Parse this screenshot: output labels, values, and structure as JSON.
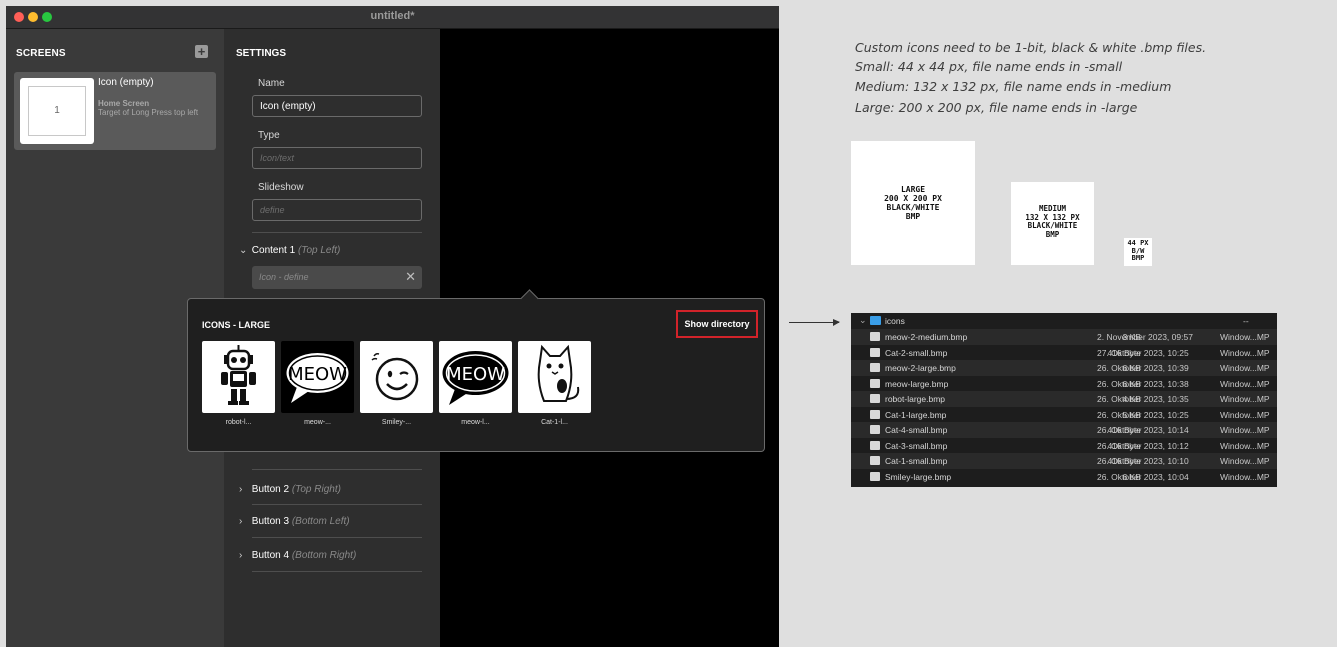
{
  "window": {
    "title": "untitled*"
  },
  "screens": {
    "title": "SCREENS",
    "add_label": "+",
    "card": {
      "number": "1",
      "name": "Icon (empty)",
      "subtitle": "Home Screen",
      "description": "Target of Long Press top left"
    }
  },
  "settings": {
    "title": "SETTINGS",
    "name_label": "Name",
    "name_value": "Icon (empty)",
    "type_label": "Type",
    "type_placeholder": "Icon/text",
    "slideshow_label": "Slideshow",
    "slideshow_placeholder": "define",
    "content1": {
      "label": "Content 1",
      "sub": "(Top Left)",
      "icon_placeholder": "Icon - define",
      "clear": "✕"
    },
    "buttons": [
      {
        "label": "Button 2",
        "sub": "(Top Right)"
      },
      {
        "label": "Button 3",
        "sub": "(Bottom Left)"
      },
      {
        "label": "Button 4",
        "sub": "(Bottom Right)"
      }
    ]
  },
  "popover": {
    "title": "ICONS - LARGE",
    "show_directory": "Show directory",
    "icons": [
      {
        "caption": "robot-l...",
        "icon": "robot-icon"
      },
      {
        "caption": "meow-...",
        "icon": "meow-speech-icon"
      },
      {
        "caption": "Smiley-...",
        "icon": "smiley-icon"
      },
      {
        "caption": "meow-l...",
        "icon": "meow-speech-icon"
      },
      {
        "caption": "Cat-1-l...",
        "icon": "cat-icon"
      }
    ]
  },
  "notes": [
    "Custom icons need to be 1-bit, black & white .bmp files.",
    "Small: 44 x 44 px, file name ends in -small",
    "Medium: 132 x 132 px, file name ends in -medium",
    "Large: 200 x 200 px, file name ends in -large"
  ],
  "specs": {
    "large": [
      "LARGE",
      "200 X 200 PX",
      "BLACK/WHITE",
      "BMP"
    ],
    "medium": [
      "MEDIUM",
      "132 X 132 PX",
      "BLACK/WHITE",
      "BMP"
    ],
    "small": [
      "44 PX",
      "B/W",
      "BMP"
    ]
  },
  "finder": {
    "folder": "icons",
    "folder_date": "--",
    "files": [
      {
        "name": "meow-2-medium.bmp",
        "date": "2. November 2023, 09:57",
        "size": "3 KB",
        "kind": "Window...MP"
      },
      {
        "name": "Cat-2-small.bmp",
        "date": "27. Oktober 2023, 10:25",
        "size": "416 Byte",
        "kind": "Window...MP"
      },
      {
        "name": "meow-2-large.bmp",
        "date": "26. Oktober 2023, 10:39",
        "size": "6 KB",
        "kind": "Window...MP"
      },
      {
        "name": "meow-large.bmp",
        "date": "26. Oktober 2023, 10:38",
        "size": "6 KB",
        "kind": "Window...MP"
      },
      {
        "name": "robot-large.bmp",
        "date": "26. Oktober 2023, 10:35",
        "size": "4 KB",
        "kind": "Window...MP"
      },
      {
        "name": "Cat-1-large.bmp",
        "date": "26. Oktober 2023, 10:25",
        "size": "5 KB",
        "kind": "Window...MP"
      },
      {
        "name": "Cat-4-small.bmp",
        "date": "26. Oktober 2023, 10:14",
        "size": "416 Byte",
        "kind": "Window...MP"
      },
      {
        "name": "Cat-3-small.bmp",
        "date": "26. Oktober 2023, 10:12",
        "size": "416 Byte",
        "kind": "Window...MP"
      },
      {
        "name": "Cat-1-small.bmp",
        "date": "26. Oktober 2023, 10:10",
        "size": "416 Byte",
        "kind": "Window...MP"
      },
      {
        "name": "Smiley-large.bmp",
        "date": "26. Oktober 2023, 10:04",
        "size": "6 KB",
        "kind": "Window...MP"
      }
    ]
  }
}
